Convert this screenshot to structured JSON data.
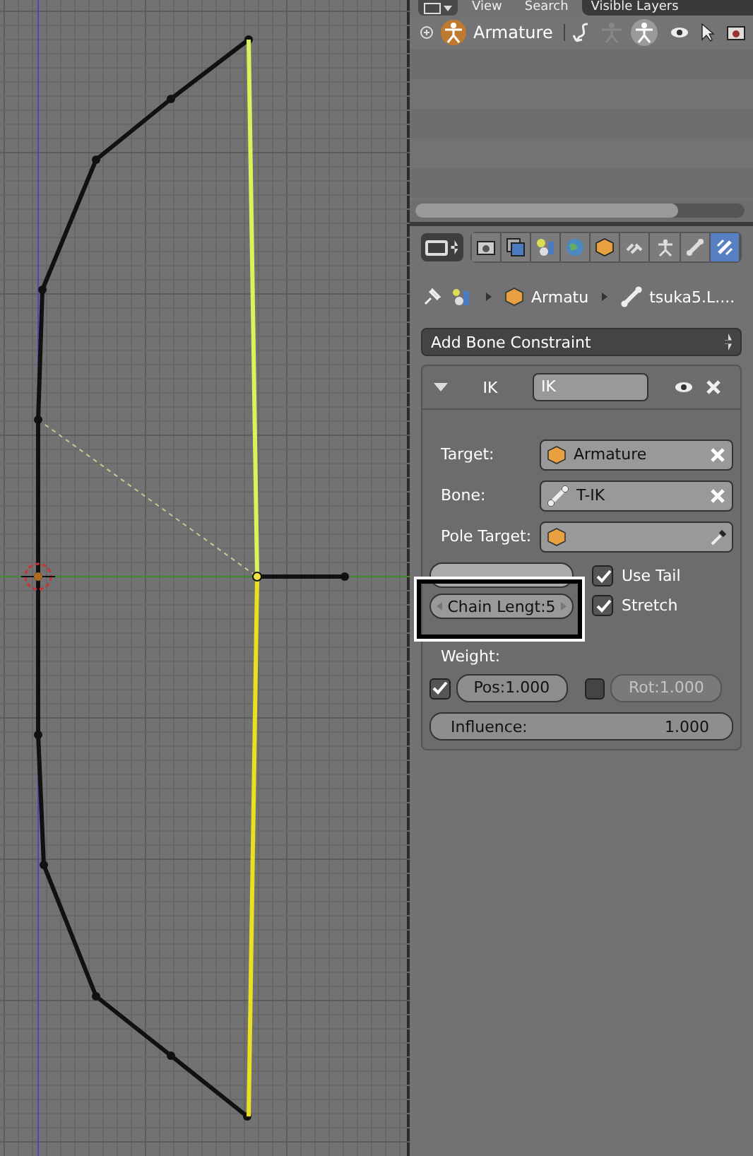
{
  "outliner": {
    "header_tabs": [
      {
        "label": "View",
        "selected": false
      },
      {
        "label": "Search",
        "selected": false
      },
      {
        "label": "Visible Layers",
        "selected": true
      }
    ],
    "rows": [
      {
        "name": "Armature",
        "expanded": false
      }
    ],
    "scroll": {
      "level": 0.8
    }
  },
  "properties": {
    "tabs": [
      {
        "kind": "render",
        "selected": false
      },
      {
        "kind": "layers",
        "selected": false
      },
      {
        "kind": "scene",
        "selected": false
      },
      {
        "kind": "world",
        "selected": false
      },
      {
        "kind": "object",
        "selected": false
      },
      {
        "kind": "constraint",
        "selected": false
      },
      {
        "kind": "data",
        "selected": false
      },
      {
        "kind": "bone",
        "selected": false
      },
      {
        "kind": "bone_constraint",
        "selected": true
      }
    ],
    "breadcrumb": [
      {
        "kind": "scene"
      },
      {
        "kind": "object",
        "label": "Armatu"
      },
      {
        "kind": "bone",
        "label": "tsuka5.L...."
      }
    ],
    "add_menu": "Add Bone Constraint",
    "constraint": {
      "expanded": true,
      "type": "IK",
      "name": "IK",
      "visible": true,
      "fields": [
        {
          "label": "Target:",
          "kind": "object",
          "value": "Armature",
          "clearable": true
        },
        {
          "label": "Bone:",
          "kind": "bone",
          "value": "T-IK",
          "clearable": true
        },
        {
          "label": "Pole Target:",
          "kind": "object",
          "clearable": false
        }
      ],
      "chain_length": "Chain Lengt:5",
      "use_tail": {
        "label": "Use Tail",
        "checked": true
      },
      "stretch": {
        "label": "Stretch",
        "checked": true
      },
      "weight_label": "Weight:",
      "pos": {
        "label": "Pos:1.000",
        "checked": true
      },
      "rot": {
        "label": "Rot:1.000",
        "checked": false
      },
      "influence": {
        "label": "Influence:",
        "value": "1.000",
        "level": 1
      }
    }
  }
}
